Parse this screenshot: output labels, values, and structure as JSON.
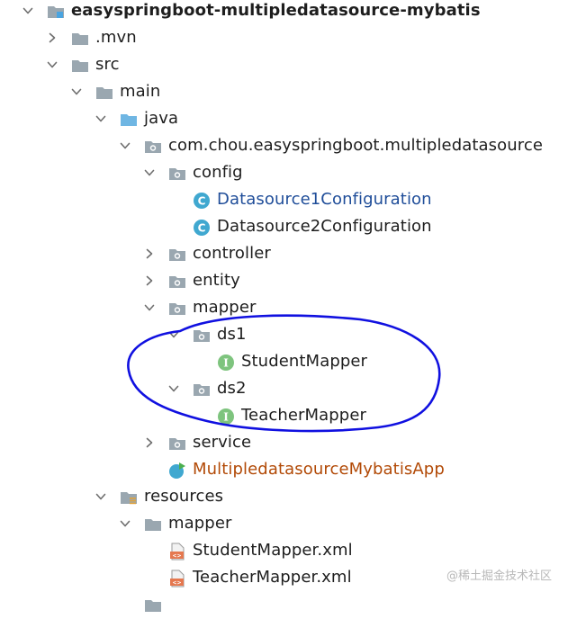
{
  "project": {
    "name": "easyspringboot-multipledatasource-mybatis"
  },
  "tree": {
    "mvn": ".mvn",
    "src": "src",
    "main": "main",
    "java": "java",
    "package": "com.chou.easyspringboot.multipledatasource",
    "config": "config",
    "ds1_config": "Datasource1Configuration",
    "ds2_config": "Datasource2Configuration",
    "controller": "controller",
    "entity": "entity",
    "mapper": "mapper",
    "ds1": "ds1",
    "student_mapper": "StudentMapper",
    "ds2": "ds2",
    "teacher_mapper": "TeacherMapper",
    "service": "service",
    "app": "MultipledatasourceMybatisApp",
    "resources": "resources",
    "res_mapper": "mapper",
    "student_xml": "StudentMapper.xml",
    "teacher_xml": "TeacherMapper.xml"
  },
  "icon_badges": {
    "class_badge": "C",
    "interface_badge": "I",
    "xml_badge": "<>"
  },
  "watermark": "@稀土掘金技术社区",
  "colors": {
    "folder_gray": "#9aa7b0",
    "source_folder_blue": "#6fb6e3",
    "class_icon": "#40a8d0",
    "interface_icon": "#7ec47e",
    "selected_text_blue": "#1f4d99",
    "app_text_brown": "#b24a07",
    "annotation_ellipse": "#1010e0",
    "xml_orange": "#e5784f"
  }
}
